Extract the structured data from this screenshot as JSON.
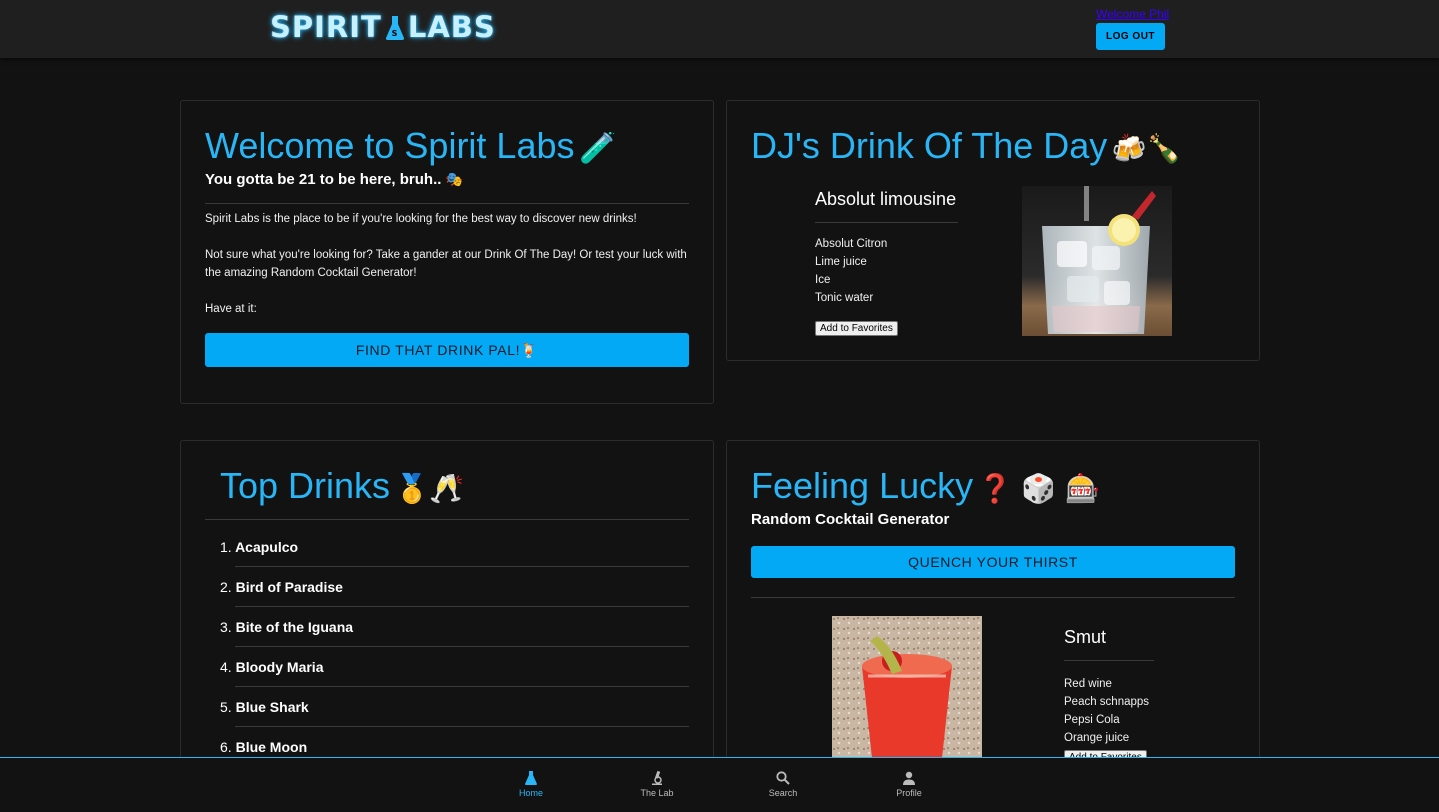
{
  "header": {
    "logo_left": "SPIRIT",
    "logo_flask_letter": "S",
    "logo_right": "LABS",
    "welcome_link": "Welcome Phil",
    "logout_label": "LOG OUT"
  },
  "welcome_card": {
    "title": "Welcome to Spirit Labs",
    "title_emoji": "🧪",
    "subtitle": "You gotta be 21 to be here, bruh..",
    "subtitle_emoji": "🎭",
    "paragraph1": "Spirit Labs is the place to be if you're looking for the best way to discover new drinks!",
    "paragraph2": "Not sure what you're looking for? Take a gander at our Drink Of The Day! Or test your luck with the amazing Random Cocktail Generator!",
    "paragraph3": "Have at it:",
    "button_label": "FIND THAT DRINK PAL!🍹"
  },
  "dotd_card": {
    "title": "DJ's Drink Of The Day",
    "title_emoji": "🍻🍾",
    "drink_name": "Absolut limousine",
    "ingredients": [
      "Absolut Citron",
      "Lime juice",
      "Ice",
      "Tonic water"
    ],
    "fav_label": "Add to Favorites"
  },
  "top_card": {
    "title": "Top Drinks",
    "title_emoji": "🥇🥂",
    "items": [
      {
        "num": "1.",
        "name": "Acapulco"
      },
      {
        "num": "2.",
        "name": "Bird of Paradise"
      },
      {
        "num": "3.",
        "name": "Bite of the Iguana"
      },
      {
        "num": "4.",
        "name": "Bloody Maria"
      },
      {
        "num": "5.",
        "name": "Blue Shark"
      },
      {
        "num": "6.",
        "name": "Blue Moon"
      }
    ]
  },
  "lucky_card": {
    "title": "Feeling Lucky",
    "title_emoji": "❓ 🎲 🎰",
    "subtitle": "Random Cocktail Generator",
    "button_label": "QUENCH YOUR THIRST",
    "drink_name": "Smut",
    "ingredients": [
      "Red wine",
      "Peach schnapps",
      "Pepsi Cola",
      "Orange juice"
    ],
    "fav_label": "Add to Favorites"
  },
  "bottom_nav": {
    "items": [
      {
        "label": "Home",
        "icon": "flask-icon"
      },
      {
        "label": "The Lab",
        "icon": "microscope-icon"
      },
      {
        "label": "Search",
        "icon": "search-icon"
      },
      {
        "label": "Profile",
        "icon": "person-icon"
      }
    ]
  },
  "colors": {
    "accent": "#29b6f6",
    "button": "#03a9f4",
    "background": "#121212",
    "header": "#1f1f1f"
  }
}
